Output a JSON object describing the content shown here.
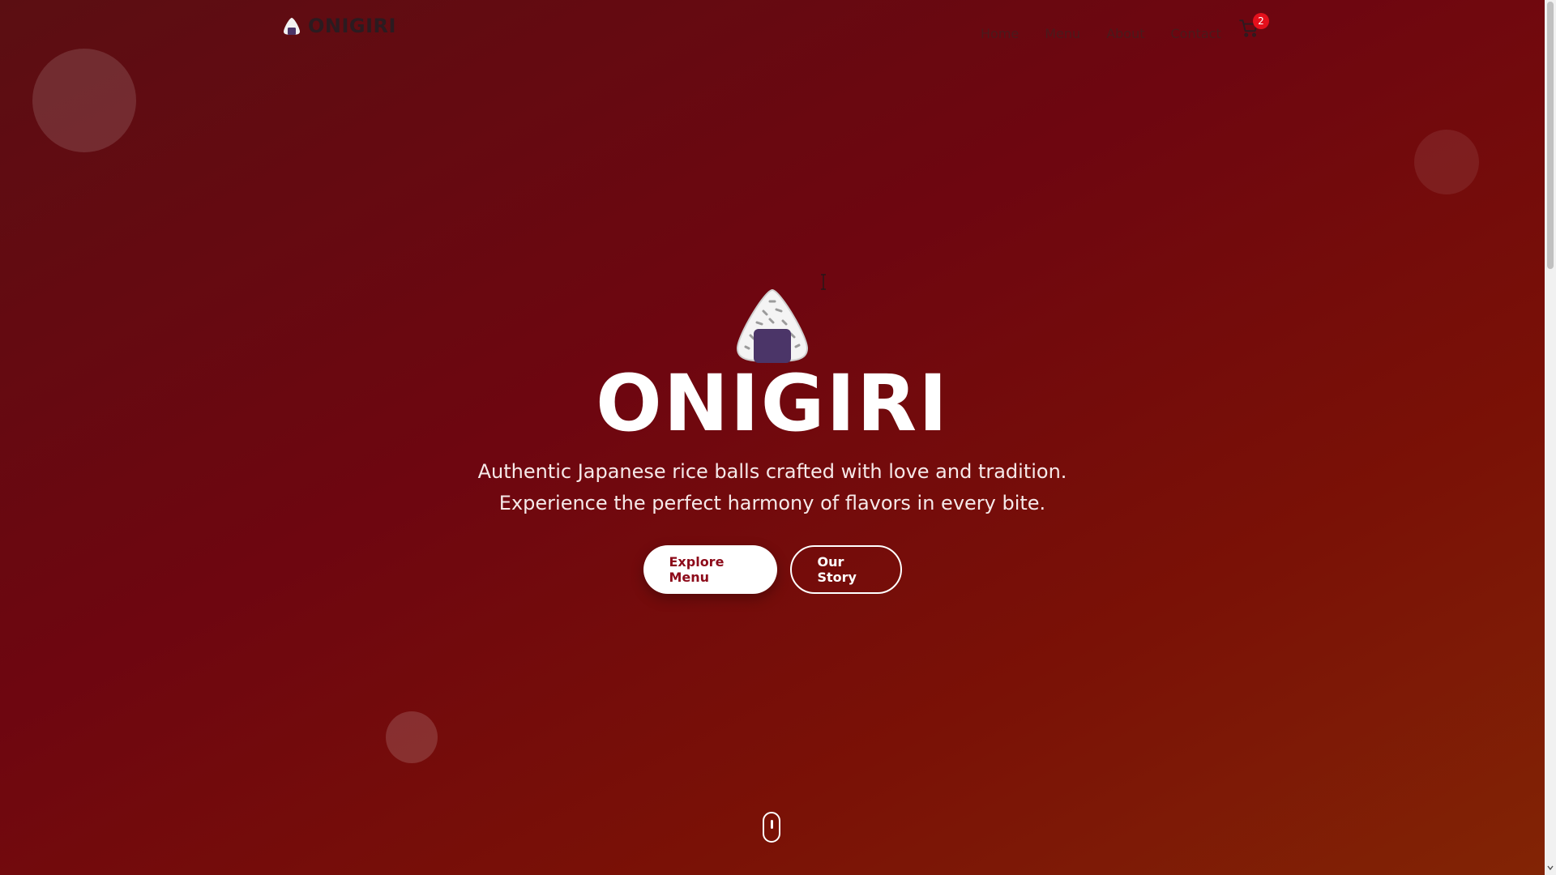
{
  "brand": {
    "name": "ONIGIRI",
    "logo_icon": "onigiri-icon"
  },
  "nav": {
    "links": [
      {
        "label": "Home"
      },
      {
        "label": "Menu"
      },
      {
        "label": "About"
      },
      {
        "label": "Contact"
      }
    ],
    "cart": {
      "icon": "cart-icon",
      "count": "2"
    }
  },
  "hero": {
    "icon": "onigiri-icon",
    "title": "ONIGIRI",
    "subtitle": "Authentic Japanese rice balls crafted with love and tradition. Experience the perfect harmony of flavors in every bite.",
    "primary_button": "Explore Menu",
    "secondary_button": "Our Story",
    "scroll_icon": "mouse-scroll-icon"
  },
  "colors": {
    "background_start": "#5b0e12",
    "background_end": "#822405",
    "primary_button_text": "#8d0b1a",
    "badge": "#e4101c",
    "nori": "#4b3568"
  }
}
